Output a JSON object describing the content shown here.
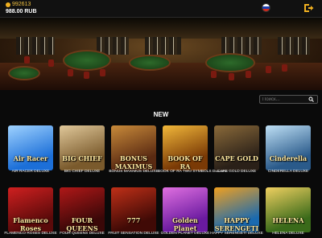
{
  "account": {
    "id": "992613",
    "balance": "988.00 RUB"
  },
  "header": {
    "language_flag": "ru",
    "logout_icon": "logout-icon"
  },
  "search": {
    "placeholder": "Поиск..."
  },
  "section": {
    "title": "NEW"
  },
  "games": [
    {
      "title": "AIR RACER DELUXE",
      "logo": "Air Racer",
      "colors": [
        "#1c6fd8",
        "#9fd2ff"
      ]
    },
    {
      "title": "BIG CHIEF DELUXE",
      "logo": "BIG CHIEF",
      "colors": [
        "#7a5a2c",
        "#e0c89a"
      ]
    },
    {
      "title": "BONUS MAXIMUS DELUXE",
      "logo": "BONUS MAXIMUS",
      "colors": [
        "#5a2a12",
        "#c88a3a"
      ]
    },
    {
      "title": "BOOK OF RA TWO SYMBOLS DELUXE",
      "logo": "BOOK OF RA",
      "colors": [
        "#7a3a06",
        "#f2b83a"
      ]
    },
    {
      "title": "CAPE GOLD DELUXE",
      "logo": "CAPE GOLD",
      "colors": [
        "#2a2018",
        "#8a6a3a"
      ]
    },
    {
      "title": "CINDERELLA DELUXE",
      "logo": "Cinderella",
      "colors": [
        "#2a5a8a",
        "#bfe0f5"
      ]
    },
    {
      "title": "FLAMENCO ROSES DELUXE",
      "logo": "Flamenco Roses",
      "colors": [
        "#5a0a0a",
        "#d02020"
      ]
    },
    {
      "title": "FOUR QUEENS DELUXE",
      "logo": "FOUR QUEENS",
      "colors": [
        "#3a0808",
        "#b01818"
      ]
    },
    {
      "title": "FRUIT SENSATION DELUXE",
      "logo": "777",
      "colors": [
        "#400a06",
        "#c03018"
      ]
    },
    {
      "title": "GOLDEN PLANET DELUXE",
      "logo": "Golden Planet",
      "colors": [
        "#6a1aa0",
        "#e070e0"
      ]
    },
    {
      "title": "HAPPY SERENGETI DELUXE",
      "logo": "HAPPY SERENGETI",
      "colors": [
        "#1a6ab0",
        "#f0a020"
      ]
    },
    {
      "title": "HELENA DELUXE",
      "logo": "HELENA",
      "colors": [
        "#3a6a1a",
        "#f0d060"
      ]
    }
  ]
}
